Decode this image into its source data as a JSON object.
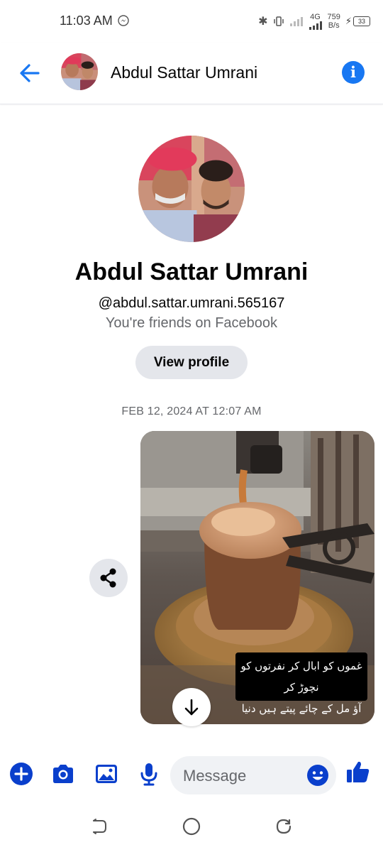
{
  "status_bar": {
    "time": "11:03 AM",
    "network_type": "4G",
    "speed_value": "759",
    "speed_unit": "B/s",
    "battery": "33"
  },
  "header": {
    "contact_name": "Abdul Sattar Umrani",
    "back_icon": "arrow-left-icon",
    "info_icon": "info-icon"
  },
  "profile": {
    "name": "Abdul Sattar Umrani",
    "handle": "@abdul.sattar.umrani.565167",
    "friends_text": "You're friends on Facebook",
    "view_profile_label": "View profile"
  },
  "conversation": {
    "timestamp": "FEB 12, 2024 AT 12:07 AM",
    "shared_image": {
      "caption_line1": "غموں کو ابال کر نفرتوں کو نچوڑ کر",
      "caption_line2": "آؤ مل کے چائے پیتے ہیں دنیا کو چھوڑ کر"
    }
  },
  "composer": {
    "placeholder": "Message",
    "icons": [
      "plus-icon",
      "camera-icon",
      "gallery-icon",
      "microphone-icon",
      "emoji-icon",
      "thumbs-up-icon"
    ]
  },
  "colors": {
    "accent": "#1877f2",
    "composer_blue": "#0a3fcc",
    "secondary_text": "#65676b",
    "button_bg": "#e4e6eb"
  }
}
